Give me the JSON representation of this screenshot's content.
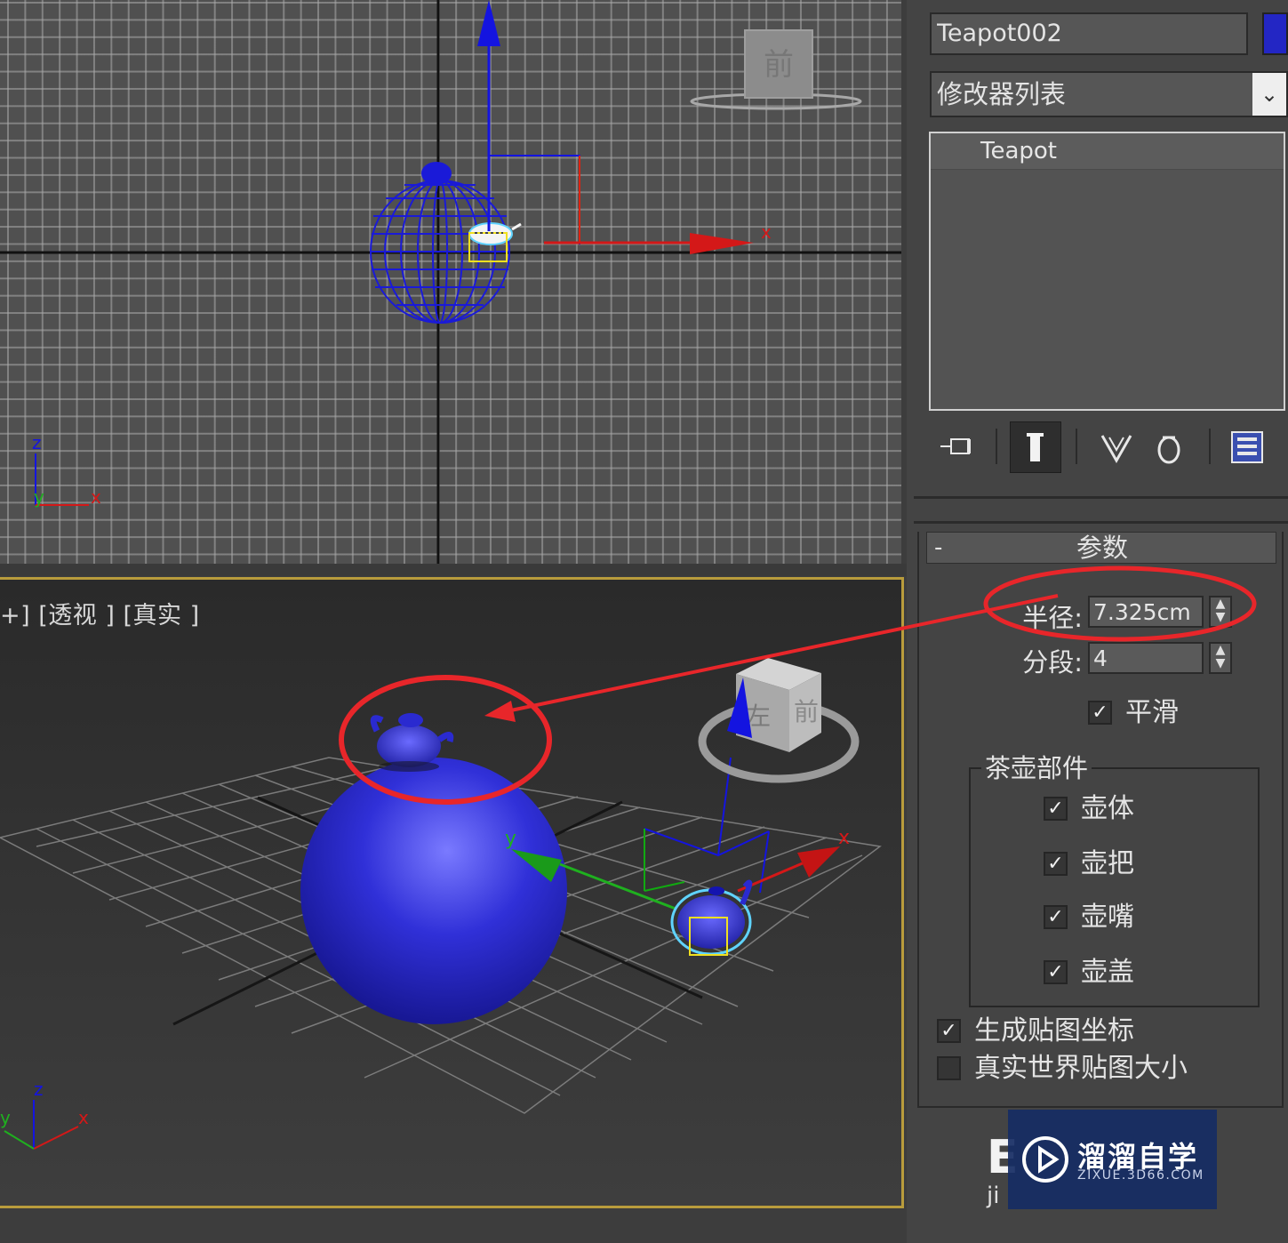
{
  "viewport_top": {
    "axis_label_x": "x",
    "gizmo_z": "z",
    "gizmo_y": "y",
    "gizmo_x": "x",
    "viewcube_label": "前"
  },
  "viewport_persp": {
    "label": "+] [透视 ] [真实 ]",
    "axis_label_x": "x",
    "axis_label_y": "y",
    "gizmo_z": "z",
    "gizmo_y": "y",
    "gizmo_x": "x",
    "viewcube_front": "前",
    "viewcube_left": "左"
  },
  "panel": {
    "object_name": "Teapot002",
    "object_color": "#2326c4",
    "modifier_list": "修改器列表",
    "stack_item": "Teapot",
    "toolbar_icons": [
      "pin-stack-icon",
      "show-end-result-icon",
      "make-unique-icon",
      "remove-modifier-icon",
      "configure-modifier-sets-icon"
    ]
  },
  "params": {
    "collapse": "-",
    "title": "参数",
    "radius_label": "半径:",
    "radius_value": "7.325cm",
    "segments_label": "分段:",
    "segments_value": "4",
    "smooth_label": "平滑",
    "smooth_checked": true,
    "parts_title": "茶壶部件",
    "parts": [
      {
        "label": "壶体",
        "checked": true
      },
      {
        "label": "壶把",
        "checked": true
      },
      {
        "label": "壶嘴",
        "checked": true
      },
      {
        "label": "壶盖",
        "checked": true
      }
    ],
    "gen_mapping_label": "生成贴图坐标",
    "gen_mapping_checked": true,
    "real_world_label": "真实世界贴图大小",
    "real_world_checked": false
  },
  "annotation": {
    "color": "#e8262a"
  },
  "watermark": {
    "partial_letter": "E",
    "partial_text": "ji",
    "cn": "溜溜自学",
    "en": "ZIXUE.3D66.COM"
  }
}
